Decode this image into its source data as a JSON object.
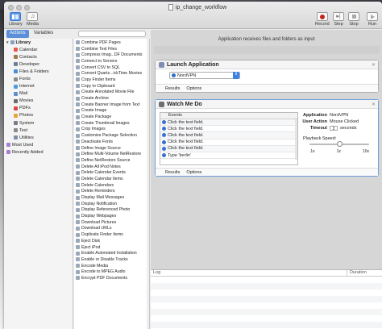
{
  "window": {
    "title": "ip_change_workflow"
  },
  "toolbar": {
    "library_label": "Library",
    "media_label": "Media",
    "record_label": "Record",
    "step_label": "Step",
    "stop_label": "Stop",
    "run_label": "Run"
  },
  "tabs": {
    "actions": "Actions",
    "variables": "Variables"
  },
  "library": {
    "root": "Library",
    "items": [
      "Calendar",
      "Contacts",
      "Developer",
      "Files & Folders",
      "Fonts",
      "Internet",
      "Mail",
      "Movies",
      "PDFs",
      "Photos",
      "System",
      "Text",
      "Utilities"
    ],
    "most_used": "Most Used",
    "recently_added": "Recently Added"
  },
  "actions_list": [
    "Combine PDF Pages",
    "Combine Text Files",
    "Compress Imag...DF Documents",
    "Connect to Servers",
    "Convert CSV to SQL",
    "Convert Quartz...ickTime Movies",
    "Copy Finder Items",
    "Copy to Clipboard",
    "Create Annotated Movie File",
    "Create Archive",
    "Create Banner Image from Text",
    "Create Image",
    "Create Package",
    "Create Thumbnail Images",
    "Crop Images",
    "Customize Package Selection",
    "Deactivate Fonts",
    "Define Image Source",
    "Define Multi-Volume NetRestore",
    "Define NetRestore Source",
    "Delete All iPod Notes",
    "Delete Calendar Events",
    "Delete Calendar Items",
    "Delete Calendars",
    "Delete Reminders",
    "Display Mail Messages",
    "Display Notification",
    "Display Referenced Photo",
    "Display Webpages",
    "Download Pictures",
    "Download URLs",
    "Duplicate Finder Items",
    "Eject Disk",
    "Eject iPod",
    "Enable Automated Installation",
    "Enable or Disable Tracks",
    "Encode Media",
    "Encode to MPEG Audio",
    "Encrypt PDF Documents"
  ],
  "workflow": {
    "receives_text": "Application receives files and folders as input",
    "launch": {
      "title": "Launch Application",
      "selected_app": "NordVPN",
      "results_label": "Results",
      "options_label": "Options"
    },
    "watch": {
      "title": "Watch Me Do",
      "events_header": "Events",
      "events": [
        "Click the text field.",
        "Click the text field.",
        "Click the text field.",
        "Click the text field.",
        "Click the text field.",
        "Type 'berlin'"
      ],
      "application_key": "Application",
      "application_value": "NordVPN",
      "user_action_key": "User Action",
      "user_action_value": "Mouse Clicked",
      "timeout_key": "Timeout",
      "timeout_value": "2",
      "timeout_unit": "seconds",
      "playback_label": "Playback Speed:",
      "playback_ticks": [
        ".1x",
        "1x",
        "10x"
      ],
      "playback_value": "1x",
      "results_label": "Results",
      "options_label": "Options"
    }
  },
  "log": {
    "col_log": "Log",
    "col_duration": "Duration"
  },
  "colors": {
    "accent": "#5b8fd8",
    "record_red": "#c8221e"
  },
  "icons": [
    "library-icon",
    "media-icon",
    "record-icon",
    "step-icon",
    "stop-icon",
    "run-icon",
    "document-icon"
  ]
}
